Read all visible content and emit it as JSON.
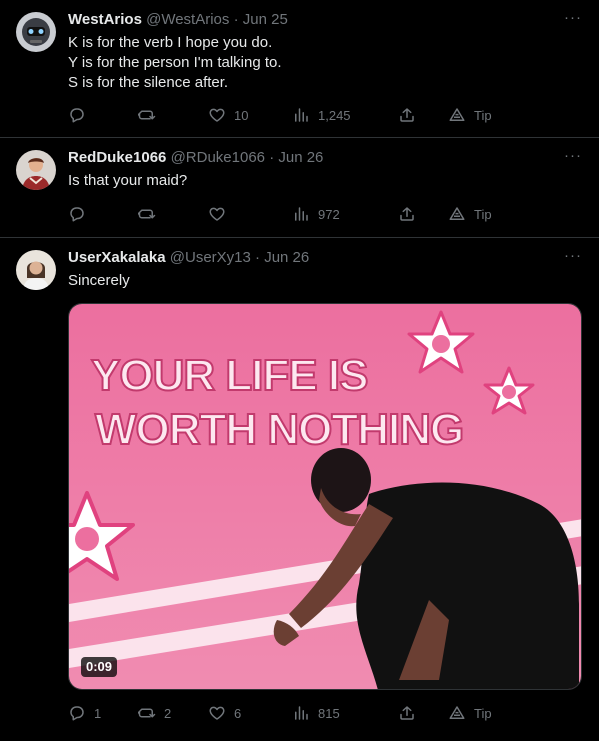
{
  "tweets": [
    {
      "name": "WestArios",
      "handle": "@WestArios",
      "separator": "·",
      "date": "Jun 25",
      "lines": [
        "K is for the verb I hope you do.",
        "Y is for the person I'm talking to.",
        "S is for the silence after."
      ],
      "reply_count": "",
      "retweet_count": "",
      "like_count": "10",
      "view_count": "1,245",
      "tip_label": "Tip"
    },
    {
      "name": "RedDuke1066",
      "handle": "@RDuke1066",
      "separator": "·",
      "date": "Jun 26",
      "lines": [
        "Is that your maid?"
      ],
      "reply_count": "",
      "retweet_count": "",
      "like_count": "",
      "view_count": "972",
      "tip_label": "Tip"
    },
    {
      "name": "UserXakalaka",
      "handle": "@UserXy13",
      "separator": "·",
      "date": "Jun 26",
      "lines": [
        "Sincerely"
      ],
      "media": {
        "caption_line1": "YOUR LIFE IS",
        "caption_line2": "WORTH NOTHING",
        "duration": "0:09"
      },
      "reply_count": "1",
      "retweet_count": "2",
      "like_count": "6",
      "view_count": "815",
      "tip_label": "Tip"
    }
  ],
  "more_glyph": "···",
  "colors": {
    "background": "#000000",
    "text": "#e7e9ea",
    "muted": "#71767b",
    "divider": "#2f3336",
    "media_pink": "#e8699a"
  }
}
